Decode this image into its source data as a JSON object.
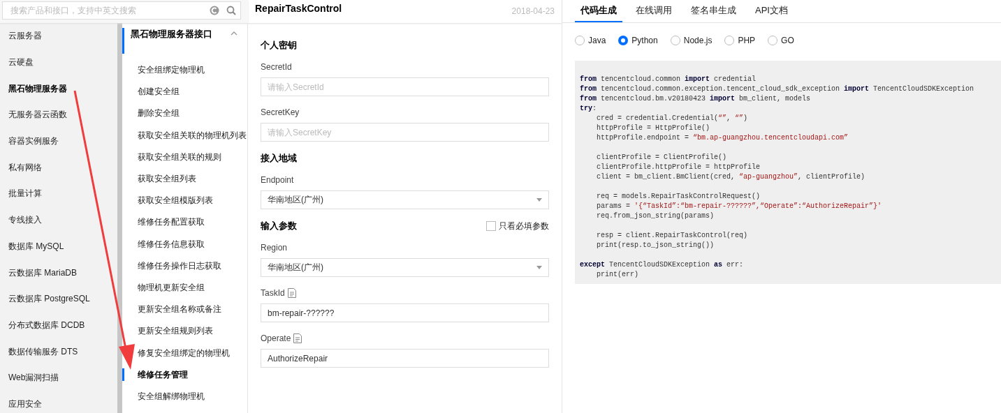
{
  "search": {
    "placeholder": "搜索产品和接口，支持中英文搜索"
  },
  "products": [
    {
      "label": "云服务器",
      "selected": false
    },
    {
      "label": "云硬盘",
      "selected": false
    },
    {
      "label": "黑石物理服务器",
      "selected": true
    },
    {
      "label": "无服务器云函数",
      "selected": false
    },
    {
      "label": "容器实例服务",
      "selected": false
    },
    {
      "label": "私有网络",
      "selected": false
    },
    {
      "label": "批量计算",
      "selected": false
    },
    {
      "label": "专线接入",
      "selected": false
    },
    {
      "label": "数据库 MySQL",
      "selected": false
    },
    {
      "label": "云数据库 MariaDB",
      "selected": false
    },
    {
      "label": "云数据库 PostgreSQL",
      "selected": false
    },
    {
      "label": "分布式数据库 DCDB",
      "selected": false
    },
    {
      "label": "数据传输服务 DTS",
      "selected": false
    },
    {
      "label": "Web漏洞扫描",
      "selected": false
    },
    {
      "label": "应用安全",
      "selected": false
    }
  ],
  "api_nav": {
    "title": "黑石物理服务器接口",
    "expanded": true,
    "items": [
      {
        "label": "安全组绑定物理机",
        "selected": false
      },
      {
        "label": "创建安全组",
        "selected": false
      },
      {
        "label": "删除安全组",
        "selected": false
      },
      {
        "label": "获取安全组关联的物理机列表",
        "selected": false
      },
      {
        "label": "获取安全组关联的规则",
        "selected": false
      },
      {
        "label": "获取安全组列表",
        "selected": false
      },
      {
        "label": "获取安全组模版列表",
        "selected": false
      },
      {
        "label": "维修任务配置获取",
        "selected": false
      },
      {
        "label": "维修任务信息获取",
        "selected": false
      },
      {
        "label": "维修任务操作日志获取",
        "selected": false
      },
      {
        "label": "物理机更新安全组",
        "selected": false
      },
      {
        "label": "更新安全组名称或备注",
        "selected": false
      },
      {
        "label": "更新安全组规则列表",
        "selected": false
      },
      {
        "label": "修复安全组绑定的物理机",
        "selected": false
      },
      {
        "label": "维修任务管理",
        "selected": true
      },
      {
        "label": "安全组解绑物理机",
        "selected": false
      }
    ]
  },
  "api_header": {
    "title": "RepairTaskControl",
    "date": "2018-04-23"
  },
  "form": {
    "sections": [
      {
        "title": "个人密钥",
        "fields": [
          {
            "label": "SecretId",
            "kind": "text",
            "placeholder": "请输入SecretId"
          },
          {
            "label": "SecretKey",
            "kind": "text",
            "placeholder": "请输入SecretKey"
          }
        ]
      },
      {
        "title": "接入地域",
        "fields": [
          {
            "label": "Endpoint",
            "kind": "select",
            "value": "华南地区(广州)"
          }
        ]
      },
      {
        "title": "输入参数",
        "filter": {
          "label": "只看必填参数",
          "checked": false
        },
        "fields": [
          {
            "label": "Region",
            "kind": "select",
            "value": "华南地区(广州)"
          },
          {
            "label": "TaskId",
            "kind": "text",
            "value": "bm-repair-??????",
            "has_doc": true
          },
          {
            "label": "Operate",
            "kind": "text",
            "value": "AuthorizeRepair",
            "has_doc": true
          }
        ]
      }
    ]
  },
  "tabs": [
    {
      "label": "代码生成",
      "selected": true
    },
    {
      "label": "在线调用",
      "selected": false
    },
    {
      "label": "签名串生成",
      "selected": false
    },
    {
      "label": "API文档",
      "selected": false
    }
  ],
  "languages": [
    {
      "label": "Java",
      "selected": false
    },
    {
      "label": "Python",
      "selected": true
    },
    {
      "label": "Node.js",
      "selected": false
    },
    {
      "label": "PHP",
      "selected": false
    },
    {
      "label": "GO",
      "selected": false
    }
  ],
  "code": {
    "lines": [
      {
        "segments": [
          {
            "kind": "keyword",
            "text": "from"
          },
          {
            "kind": "plain",
            "text": " tencentcloud.common "
          },
          {
            "kind": "keyword",
            "text": "import"
          },
          {
            "kind": "plain",
            "text": " credential"
          }
        ]
      },
      {
        "segments": [
          {
            "kind": "keyword",
            "text": "from"
          },
          {
            "kind": "plain",
            "text": " tencentcloud.common.exception.tencent_cloud_sdk_exception "
          },
          {
            "kind": "keyword",
            "text": "import"
          },
          {
            "kind": "plain",
            "text": " TencentCloudSDKException"
          }
        ]
      },
      {
        "segments": [
          {
            "kind": "keyword",
            "text": "from"
          },
          {
            "kind": "plain",
            "text": " tencentcloud.bm.v20180423 "
          },
          {
            "kind": "keyword",
            "text": "import"
          },
          {
            "kind": "plain",
            "text": " bm_client, models"
          }
        ]
      },
      {
        "segments": [
          {
            "kind": "keyword",
            "text": "try"
          },
          {
            "kind": "plain",
            "text": ":"
          }
        ]
      },
      {
        "segments": [
          {
            "kind": "plain",
            "text": "    cred = credential.Credential("
          },
          {
            "kind": "string",
            "text": "“”"
          },
          {
            "kind": "plain",
            "text": ", "
          },
          {
            "kind": "string",
            "text": "“”"
          },
          {
            "kind": "plain",
            "text": ")"
          }
        ]
      },
      {
        "segments": [
          {
            "kind": "plain",
            "text": "    httpProfile = HttpProfile()"
          }
        ]
      },
      {
        "segments": [
          {
            "kind": "plain",
            "text": "    httpProfile.endpoint = "
          },
          {
            "kind": "string",
            "text": "“bm.ap-guangzhou.tencentcloudapi.com”"
          }
        ]
      },
      {
        "gap_before": true,
        "segments": [
          {
            "kind": "plain",
            "text": "    clientProfile = ClientProfile()"
          }
        ]
      },
      {
        "segments": [
          {
            "kind": "plain",
            "text": "    clientProfile.httpProfile = httpProfile"
          }
        ]
      },
      {
        "segments": [
          {
            "kind": "plain",
            "text": "    client = bm_client.BmClient(cred, "
          },
          {
            "kind": "string",
            "text": "“ap-guangzhou”"
          },
          {
            "kind": "plain",
            "text": ", clientProfile)"
          }
        ]
      },
      {
        "gap_before": true,
        "segments": [
          {
            "kind": "plain",
            "text": "    req = models.RepairTaskControlRequest()"
          }
        ]
      },
      {
        "segments": [
          {
            "kind": "plain",
            "text": "    params = "
          },
          {
            "kind": "string",
            "text": "'{“TaskId”:“bm-repair-??????”,“Operate”:“AuthorizeRepair”}'"
          }
        ]
      },
      {
        "segments": [
          {
            "kind": "plain",
            "text": "    req.from_json_string(params)"
          }
        ]
      },
      {
        "gap_before": true,
        "segments": [
          {
            "kind": "plain",
            "text": "    resp = client.RepairTaskControl(req)"
          }
        ]
      },
      {
        "segments": [
          {
            "kind": "plain",
            "text": "    print(resp.to_json_string())"
          }
        ]
      },
      {
        "gap_before": true,
        "segments": [
          {
            "kind": "keyword",
            "text": "except"
          },
          {
            "kind": "plain",
            "text": " TencentCloudSDKException "
          },
          {
            "kind": "keyword",
            "text": "as"
          },
          {
            "kind": "plain",
            "text": " err:"
          }
        ]
      },
      {
        "segments": [
          {
            "kind": "plain",
            "text": "    print(err)"
          }
        ]
      }
    ]
  },
  "annotation": {
    "kind": "arrow"
  }
}
